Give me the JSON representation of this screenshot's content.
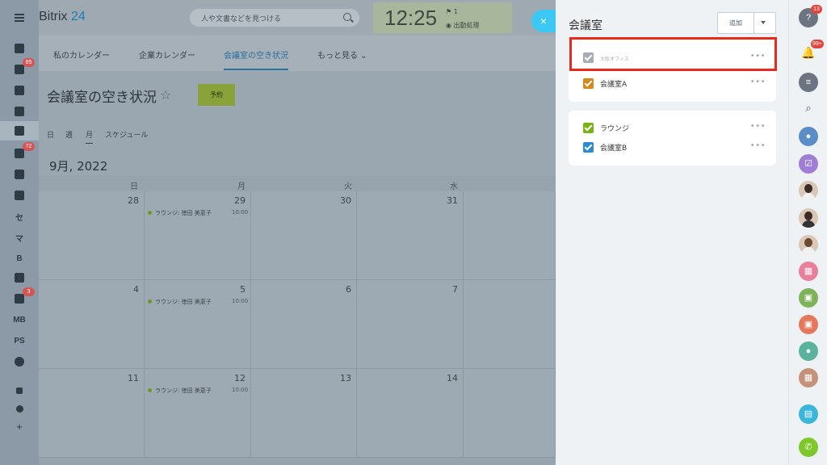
{
  "app": {
    "logo_name": "Bitrix",
    "logo_number": "24"
  },
  "search": {
    "placeholder": "人や文書などを見つける"
  },
  "clock": {
    "time": "12:25",
    "flag_count": "1",
    "state": "出勤処理"
  },
  "close_label": "×",
  "tabs": [
    {
      "label": "私のカレンダー"
    },
    {
      "label": "企業カレンダー"
    },
    {
      "label": "会議室の空き状況"
    },
    {
      "label": "もっと見る ⌄"
    }
  ],
  "page": {
    "title": "会議室の空き状況",
    "reserve_label": "予約"
  },
  "views": [
    {
      "label": "日"
    },
    {
      "label": "週"
    },
    {
      "label": "月"
    },
    {
      "label": "スケジュール"
    }
  ],
  "calendar": {
    "month_title": "9月, 2022",
    "day_headers": [
      "日",
      "月",
      "火",
      "水"
    ],
    "weeks": [
      [
        "28",
        "29",
        "30",
        "31"
      ],
      [
        "4",
        "5",
        "6",
        "7"
      ],
      [
        "11",
        "12",
        "13",
        "14"
      ]
    ],
    "events": [
      {
        "text": "ラウンジ: 徳田 美恵子",
        "time": "10:00"
      },
      {
        "text": "ラウンジ: 徳田 美恵子",
        "time": "10:00"
      },
      {
        "text": "ラウンジ: 徳田 美恵子",
        "time": "10:00"
      }
    ]
  },
  "left_sidebar": {
    "badges": {
      "tasks": "85",
      "stream": "72",
      "bot": "3"
    },
    "text_items": [
      "セ",
      "マ",
      "B",
      "MB",
      "PS"
    ]
  },
  "panel": {
    "title": "会議室",
    "add_label": "追加",
    "group1": [
      {
        "label": "大阪オフィス",
        "color": "#a8adb4",
        "muted": true
      },
      {
        "label": "会議室A",
        "color": "#d6871d",
        "muted": false
      }
    ],
    "group2": [
      {
        "label": "ラウンジ",
        "color": "#7ab317",
        "muted": false
      },
      {
        "label": "会議室B",
        "color": "#2d8bd0",
        "muted": false
      }
    ],
    "more_label": "•••"
  },
  "right_bar": {
    "help_badge": "13",
    "notify_badge": "99+"
  },
  "colors": {
    "accent": "#3bc8f5",
    "highlight": "#e8291c"
  }
}
